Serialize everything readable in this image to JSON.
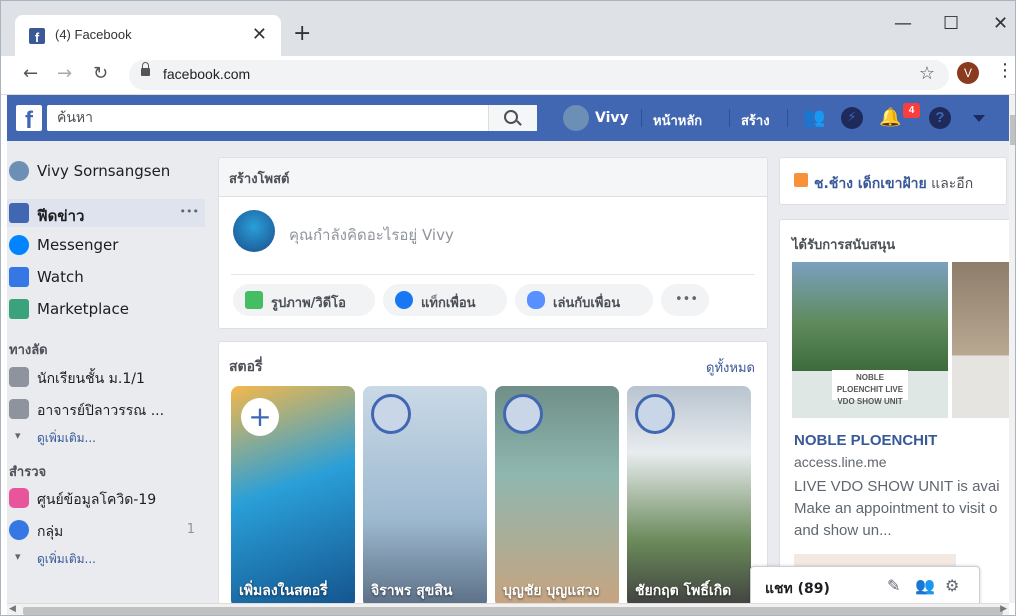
{
  "browser": {
    "tab_title": "(4) Facebook",
    "tab_close": "✕",
    "new_tab": "+",
    "url": "facebook.com",
    "profile_initial": "V",
    "window_controls": {
      "minimize": "—",
      "maximize": "☐",
      "close": "✕"
    }
  },
  "fb_header": {
    "search_placeholder": "ค้นหา",
    "user_name": "Vivy",
    "nav_home": "หน้าหลัก",
    "nav_create": "สร้าง",
    "notification_count": "4",
    "brand_color": "#4267b2"
  },
  "left_sidebar": {
    "profile_name": "Vivy Sornsangsen",
    "items": [
      {
        "label": "ฟีดข่าว",
        "icon": "news-feed-icon",
        "more": "•••"
      },
      {
        "label": "Messenger",
        "icon": "messenger-icon"
      },
      {
        "label": "Watch",
        "icon": "watch-icon"
      },
      {
        "label": "Marketplace",
        "icon": "marketplace-icon"
      }
    ],
    "shortcuts_header": "ทางลัด",
    "shortcuts": [
      {
        "label": "นักเรียนชั้น ม.1/1",
        "icon": "group-icon"
      },
      {
        "label": "อาจารย์ปิลาวรรณ ...",
        "icon": "group-icon"
      }
    ],
    "shortcuts_more": "ดูเพิ่มเติม...",
    "explore_header": "สำรวจ",
    "explore": [
      {
        "label": "ศูนย์ข้อมูลโควิด-19",
        "icon": "covid-info-icon"
      },
      {
        "label": "กลุ่ม",
        "icon": "groups-icon",
        "count": "1"
      }
    ],
    "explore_more": "ดูเพิ่มเติม..."
  },
  "composer": {
    "title": "สร้างโพสต์",
    "placeholder": "คุณกำลังคิดอะไรอยู่ Vivy",
    "actions": [
      {
        "label": "รูปภาพ/วิดีโอ",
        "icon": "photo-video-icon"
      },
      {
        "label": "แท็กเพื่อน",
        "icon": "tag-friends-icon"
      },
      {
        "label": "เล่นกับเพื่อน",
        "icon": "play-with-friends-icon"
      }
    ],
    "more": "•••"
  },
  "stories": {
    "title": "สตอรี่",
    "see_all": "ดูทั้งหมด",
    "items": [
      {
        "caption": "เพิ่มลงในสตอรี่",
        "add": "+"
      },
      {
        "caption": "จิราพร สุขสิน"
      },
      {
        "caption": "บุญชัย บุญแสวง"
      },
      {
        "caption": "ชัยกฤต โพธิ์เกิด"
      }
    ]
  },
  "right_column": {
    "birthday_text": "ช.ช้าง เด็กเขาฝ้าย",
    "birthday_suffix": " และอีก",
    "sponsored_title": "ได้รับการสนับสนุน",
    "ad_image_logo": "NOBLE PLOENCHIT LIVE VDO SHOW UNIT",
    "ad_name": "NOBLE PLOENCHIT",
    "ad_domain": "access.line.me",
    "ad_text_1": "LIVE VDO SHOW UNIT is avai",
    "ad_text_2": "Make an appointment to visit o",
    "ad_text_3": "and show un..."
  },
  "chat": {
    "label": "แชท (89)",
    "icons": [
      "compose-icon",
      "new-group-icon",
      "settings-icon"
    ]
  }
}
